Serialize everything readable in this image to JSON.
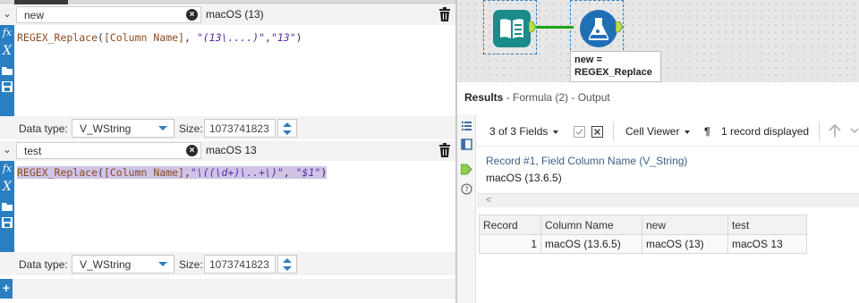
{
  "formulas": [
    {
      "name": "new",
      "preview": "macOS (13)",
      "expression": {
        "fn": "REGEX_Replace",
        "open": "(",
        "col": "[Column Name]",
        "sep1": ", ",
        "pattern": "\"(13\\....)\"",
        "sep2": ",",
        "replacement": "\"13\"",
        "close": ")"
      },
      "data_type_label": "Data type:",
      "data_type": "V_WString",
      "size_label": "Size:",
      "size": "1073741823"
    },
    {
      "name": "test",
      "preview": "macOS 13",
      "expression": {
        "fn": "REGEX_Replace",
        "open": "(",
        "col": "[Column Name]",
        "sep1": ",",
        "pattern": "\"\\((\\d+)\\..+\\)\"",
        "sep2": ", ",
        "replacement": "\"$1\"",
        "close": ")"
      },
      "data_type_label": "Data type:",
      "data_type": "V_WString",
      "size_label": "Size:",
      "size": "1073741823"
    }
  ],
  "add_button": "+",
  "canvas": {
    "annotation_line1": "new =",
    "annotation_line2": "REGEX_Replace",
    "wire_color": "#1aa31a",
    "browse_tool_color": "#1b8a8a",
    "formula_tool_color": "#1f6fb5"
  },
  "results": {
    "title": "Results",
    "subtitle": " - Formula (2) - Output",
    "fields_selector": "3 of 3 Fields",
    "viewer": "Cell Viewer",
    "pilcrow": "¶",
    "record_count": "1 record displayed",
    "record_label": "Record #1, Field Column Name (V_String)",
    "record_value": "macOS (13.6.5)",
    "columns": [
      "Record",
      "Column Name",
      "new",
      "test"
    ],
    "rows": [
      [
        "1",
        "macOS (13.6.5)",
        "macOS (13)",
        "macOS 13"
      ]
    ]
  },
  "icons": [
    "chevron-down-icon",
    "clear-icon",
    "trash-icon",
    "fx-icon",
    "x-variable-icon",
    "folder-icon",
    "save-icon",
    "add-icon",
    "dropdown-caret-icon",
    "spinner-icon",
    "browse-tool-icon",
    "formula-tool-icon",
    "list-icon",
    "checkbox-icon",
    "uncheck-icon",
    "arrow-up-icon",
    "help-icon"
  ],
  "accent": "#2b7fc0"
}
